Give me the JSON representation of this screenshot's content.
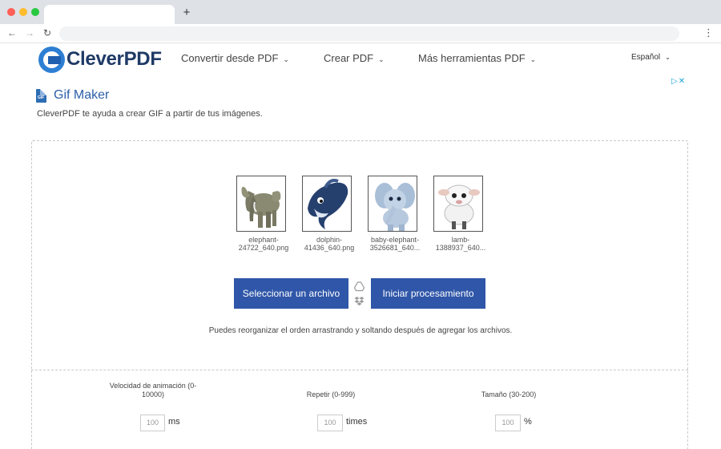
{
  "browser": {
    "new_tab": "+",
    "back": "←",
    "forward": "→",
    "reload": "↻",
    "menu": "⋮"
  },
  "header": {
    "logo_text": "CleverPDF",
    "nav": [
      {
        "label": "Convertir desde PDF"
      },
      {
        "label": "Crear PDF"
      },
      {
        "label": "Más herramientas PDF"
      }
    ],
    "language": "Español"
  },
  "page": {
    "file_icon_text": "GIF",
    "title": "Gif Maker",
    "subtitle": "CleverPDF te ayuda a crear GIF a partir de tus imágenes.",
    "ad_choice": "▷✕"
  },
  "files": [
    {
      "name": "elephant-24722_640.png",
      "line1": "elephant-",
      "line2": "24722_640.png"
    },
    {
      "name": "dolphin-41436_640.png",
      "line1": "dolphin-",
      "line2": "41436_640.png"
    },
    {
      "name": "baby-elephant-3526681_640...",
      "line1": "baby-elephant-",
      "line2": "3526681_640..."
    },
    {
      "name": "lamb-1388937_640...",
      "line1": "lamb-",
      "line2": "1388937_640..."
    }
  ],
  "actions": {
    "select_label": "Seleccionar un archivo",
    "start_label": "Iniciar procesamiento"
  },
  "hint": "Puedes reorganizar el orden arrastrando y soltando después de agregar los archivos.",
  "options": {
    "speed": {
      "label_line1": "Velocidad de animación (0-",
      "label_line2": "10000)",
      "placeholder": "100",
      "unit": "ms"
    },
    "repeat": {
      "label": "Repetir (0-999)",
      "placeholder": "100",
      "unit": "times"
    },
    "size": {
      "label": "Tamaño (30-200)",
      "placeholder": "100",
      "unit": "%"
    }
  },
  "colors": {
    "brand_blue": "#2f56a8",
    "title_blue": "#2c5ea8",
    "logo_dark": "#1f3a66"
  },
  "icons": {
    "drive": "google-drive-icon",
    "dropbox": "dropbox-icon",
    "file": "gif-file-icon"
  }
}
